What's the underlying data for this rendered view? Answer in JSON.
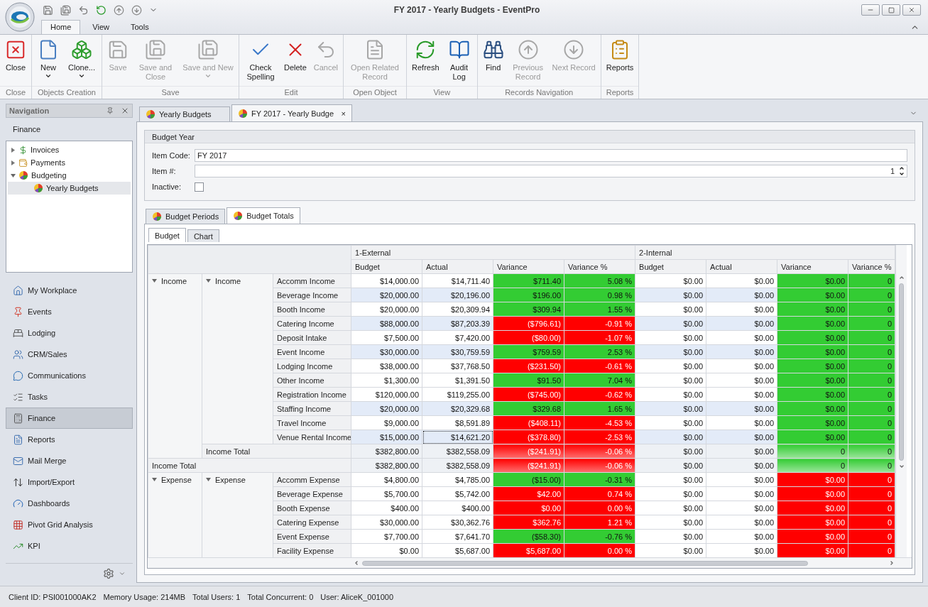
{
  "window": {
    "title": "FY 2017 - Yearly Budgets - EventPro"
  },
  "ribbon_tabs": [
    {
      "label": "Home",
      "selected": true
    },
    {
      "label": "View",
      "selected": false
    },
    {
      "label": "Tools",
      "selected": false
    }
  ],
  "ribbon_groups": [
    {
      "title": "Close",
      "buttons": [
        {
          "label": "Close",
          "disabled": false,
          "caret": false
        }
      ]
    },
    {
      "title": "Objects Creation",
      "buttons": [
        {
          "label": "New",
          "disabled": false,
          "caret": true
        },
        {
          "label": "Clone...",
          "disabled": false,
          "caret": true
        }
      ]
    },
    {
      "title": "Save",
      "buttons": [
        {
          "label": "Save",
          "disabled": true,
          "caret": false
        },
        {
          "label": "Save and Close",
          "disabled": true,
          "caret": false
        },
        {
          "label": "Save and New",
          "disabled": true,
          "caret": true
        }
      ]
    },
    {
      "title": "Edit",
      "buttons": [
        {
          "label": "Check Spelling",
          "disabled": false,
          "caret": false
        },
        {
          "label": "Delete",
          "disabled": false,
          "caret": false
        },
        {
          "label": "Cancel",
          "disabled": true,
          "caret": false
        }
      ]
    },
    {
      "title": "Open Object",
      "buttons": [
        {
          "label": "Open Related Record",
          "disabled": true,
          "caret": false
        }
      ]
    },
    {
      "title": "View",
      "buttons": [
        {
          "label": "Refresh",
          "disabled": false,
          "caret": false
        },
        {
          "label": "Audit Log",
          "disabled": false,
          "caret": false
        }
      ]
    },
    {
      "title": "Records Navigation",
      "buttons": [
        {
          "label": "Find",
          "disabled": false,
          "caret": false
        },
        {
          "label": "Previous Record",
          "disabled": true,
          "caret": false
        },
        {
          "label": "Next Record",
          "disabled": true,
          "caret": false
        }
      ]
    },
    {
      "title": "Reports",
      "buttons": [
        {
          "label": "Reports",
          "disabled": false,
          "caret": false
        }
      ]
    }
  ],
  "navigation": {
    "title": "Navigation",
    "section": "Finance",
    "tree": [
      {
        "label": "Invoices",
        "expanded": false,
        "selected": false
      },
      {
        "label": "Payments",
        "expanded": false,
        "selected": false
      },
      {
        "label": "Budgeting",
        "expanded": true,
        "selected": false,
        "children": [
          {
            "label": "Yearly Budgets",
            "selected": true
          }
        ]
      }
    ],
    "items": [
      {
        "label": "My Workplace",
        "selected": false
      },
      {
        "label": "Events",
        "selected": false
      },
      {
        "label": "Lodging",
        "selected": false
      },
      {
        "label": "CRM/Sales",
        "selected": false
      },
      {
        "label": "Communications",
        "selected": false
      },
      {
        "label": "Tasks",
        "selected": false
      },
      {
        "label": "Finance",
        "selected": true
      },
      {
        "label": "Reports",
        "selected": false
      },
      {
        "label": "Mail Merge",
        "selected": false
      },
      {
        "label": "Import/Export",
        "selected": false
      },
      {
        "label": "Dashboards",
        "selected": false
      },
      {
        "label": "Pivot Grid Analysis",
        "selected": false
      },
      {
        "label": "KPI",
        "selected": false
      }
    ]
  },
  "document_tabs": [
    {
      "label": "Yearly Budgets",
      "selected": false
    },
    {
      "label": "FY 2017 - Yearly Budge",
      "selected": true,
      "close": "×"
    }
  ],
  "form": {
    "title": "Budget Year",
    "item_code_label": "Item Code:",
    "item_code": "FY 2017",
    "item_number_label": "Item #:",
    "item_number": "1",
    "inactive_label": "Inactive:",
    "inactive": false
  },
  "detail_tabs": [
    {
      "label": "Budget Periods",
      "selected": false
    },
    {
      "label": "Budget Totals",
      "selected": true
    }
  ],
  "view_tabs": [
    {
      "label": "Budget",
      "selected": true
    },
    {
      "label": "Chart",
      "selected": false
    }
  ],
  "grid": {
    "column_groups": [
      {
        "title": "1-External",
        "columns": [
          "Budget",
          "Actual",
          "Variance",
          "Variance %"
        ]
      },
      {
        "title": "2-Internal",
        "columns": [
          "Budget",
          "Actual",
          "Variance",
          "Variance %"
        ]
      }
    ],
    "groups": [
      {
        "label": "Income",
        "expanded": true,
        "subgroups": [
          {
            "label": "Income",
            "expanded": true,
            "rows": [
              {
                "label": "Accomm Income",
                "highlighted": false,
                "focused": false,
                "external": [
                  "$14,000.00",
                  "$14,711.40",
                  "$711.40",
                  "5.08 %"
                ],
                "external_favorable": true,
                "internal": [
                  "$0.00",
                  "$0.00",
                  "$0.00",
                  "0"
                ],
                "internal_favorable": true
              },
              {
                "label": "Beverage Income",
                "highlighted": true,
                "focused": false,
                "external": [
                  "$20,000.00",
                  "$20,196.00",
                  "$196.00",
                  "0.98 %"
                ],
                "external_favorable": true,
                "internal": [
                  "$0.00",
                  "$0.00",
                  "$0.00",
                  "0"
                ],
                "internal_favorable": true
              },
              {
                "label": "Booth Income",
                "highlighted": false,
                "focused": false,
                "external": [
                  "$20,000.00",
                  "$20,309.94",
                  "$309.94",
                  "1.55 %"
                ],
                "external_favorable": true,
                "internal": [
                  "$0.00",
                  "$0.00",
                  "$0.00",
                  "0"
                ],
                "internal_favorable": true
              },
              {
                "label": "Catering Income",
                "highlighted": true,
                "focused": false,
                "external": [
                  "$88,000.00",
                  "$87,203.39",
                  "($796.61)",
                  "-0.91 %"
                ],
                "external_favorable": false,
                "internal": [
                  "$0.00",
                  "$0.00",
                  "$0.00",
                  "0"
                ],
                "internal_favorable": true
              },
              {
                "label": "Deposit Intake",
                "highlighted": false,
                "focused": false,
                "external": [
                  "$7,500.00",
                  "$7,420.00",
                  "($80.00)",
                  "-1.07 %"
                ],
                "external_favorable": false,
                "internal": [
                  "$0.00",
                  "$0.00",
                  "$0.00",
                  "0"
                ],
                "internal_favorable": true
              },
              {
                "label": "Event Income",
                "highlighted": true,
                "focused": false,
                "external": [
                  "$30,000.00",
                  "$30,759.59",
                  "$759.59",
                  "2.53 %"
                ],
                "external_favorable": true,
                "internal": [
                  "$0.00",
                  "$0.00",
                  "$0.00",
                  "0"
                ],
                "internal_favorable": true
              },
              {
                "label": "Lodging Income",
                "highlighted": false,
                "focused": false,
                "external": [
                  "$38,000.00",
                  "$37,768.50",
                  "($231.50)",
                  "-0.61 %"
                ],
                "external_favorable": false,
                "internal": [
                  "$0.00",
                  "$0.00",
                  "$0.00",
                  "0"
                ],
                "internal_favorable": true
              },
              {
                "label": "Other Income",
                "highlighted": false,
                "focused": false,
                "external": [
                  "$1,300.00",
                  "$1,391.50",
                  "$91.50",
                  "7.04 %"
                ],
                "external_favorable": true,
                "internal": [
                  "$0.00",
                  "$0.00",
                  "$0.00",
                  "0"
                ],
                "internal_favorable": true
              },
              {
                "label": "Registration Income",
                "highlighted": false,
                "focused": false,
                "external": [
                  "$120,000.00",
                  "$119,255.00",
                  "($745.00)",
                  "-0.62 %"
                ],
                "external_favorable": false,
                "internal": [
                  "$0.00",
                  "$0.00",
                  "$0.00",
                  "0"
                ],
                "internal_favorable": true
              },
              {
                "label": "Staffing Income",
                "highlighted": true,
                "focused": false,
                "external": [
                  "$20,000.00",
                  "$20,329.68",
                  "$329.68",
                  "1.65 %"
                ],
                "external_favorable": true,
                "internal": [
                  "$0.00",
                  "$0.00",
                  "$0.00",
                  "0"
                ],
                "internal_favorable": true
              },
              {
                "label": "Travel Income",
                "highlighted": false,
                "focused": false,
                "external": [
                  "$9,000.00",
                  "$8,591.89",
                  "($408.11)",
                  "-4.53 %"
                ],
                "external_favorable": false,
                "internal": [
                  "$0.00",
                  "$0.00",
                  "$0.00",
                  "0"
                ],
                "internal_favorable": true
              },
              {
                "label": "Venue Rental Income",
                "highlighted": true,
                "focused": true,
                "external": [
                  "$15,000.00",
                  "$14,621.20",
                  "($378.80)",
                  "-2.53 %"
                ],
                "external_favorable": false,
                "internal": [
                  "$0.00",
                  "$0.00",
                  "$0.00",
                  "0"
                ],
                "internal_favorable": true
              }
            ],
            "total": {
              "label": "Income Total",
              "external": [
                "$382,800.00",
                "$382,558.09",
                "($241.91)",
                "-0.06 %"
              ],
              "external_favorable": false,
              "internal": [
                "$0.00",
                "$0.00",
                "0",
                "0"
              ],
              "internal_favorable": true,
              "faded": true
            }
          }
        ],
        "total": {
          "label": "Income Total",
          "external": [
            "$382,800.00",
            "$382,558.09",
            "($241.91)",
            "-0.06 %"
          ],
          "external_favorable": false,
          "internal": [
            "$0.00",
            "$0.00",
            "0",
            "0"
          ],
          "internal_favorable": true,
          "faded": true
        }
      },
      {
        "label": "Expense",
        "expanded": true,
        "subgroups": [
          {
            "label": "Expense",
            "expanded": true,
            "rows": [
              {
                "label": "Accomm Expense",
                "highlighted": false,
                "focused": false,
                "external": [
                  "$4,800.00",
                  "$4,785.00",
                  "($15.00)",
                  "-0.31 %"
                ],
                "external_favorable": true,
                "internal": [
                  "$0.00",
                  "$0.00",
                  "$0.00",
                  "0"
                ],
                "internal_favorable": false
              },
              {
                "label": "Beverage Expense",
                "highlighted": false,
                "focused": false,
                "external": [
                  "$5,700.00",
                  "$5,742.00",
                  "$42.00",
                  "0.74 %"
                ],
                "external_favorable": false,
                "internal": [
                  "$0.00",
                  "$0.00",
                  "$0.00",
                  "0"
                ],
                "internal_favorable": false
              },
              {
                "label": "Booth Expense",
                "highlighted": false,
                "focused": false,
                "external": [
                  "$400.00",
                  "$400.00",
                  "$0.00",
                  "0.00 %"
                ],
                "external_favorable": false,
                "internal": [
                  "$0.00",
                  "$0.00",
                  "$0.00",
                  "0"
                ],
                "internal_favorable": false
              },
              {
                "label": "Catering Expense",
                "highlighted": false,
                "focused": false,
                "external": [
                  "$30,000.00",
                  "$30,362.76",
                  "$362.76",
                  "1.21 %"
                ],
                "external_favorable": false,
                "internal": [
                  "$0.00",
                  "$0.00",
                  "$0.00",
                  "0"
                ],
                "internal_favorable": false
              },
              {
                "label": "Event Expense",
                "highlighted": false,
                "focused": false,
                "external": [
                  "$7,700.00",
                  "$7,641.70",
                  "($58.30)",
                  "-0.76 %"
                ],
                "external_favorable": true,
                "internal": [
                  "$0.00",
                  "$0.00",
                  "$0.00",
                  "0"
                ],
                "internal_favorable": false
              },
              {
                "label": "Facility Expense",
                "highlighted": false,
                "focused": false,
                "external": [
                  "$0.00",
                  "$5,687.00",
                  "$5,687.00",
                  "0.00 %"
                ],
                "external_favorable": false,
                "internal": [
                  "$0.00",
                  "$0.00",
                  "$0.00",
                  "0"
                ],
                "internal_favorable": false
              }
            ]
          }
        ]
      }
    ]
  },
  "status_bar": [
    "Client ID: PSI001000AK2",
    "Memory Usage: 214MB",
    "Total Users: 1",
    "Total Concurrent: 0",
    "User: AliceK_001000"
  ]
}
